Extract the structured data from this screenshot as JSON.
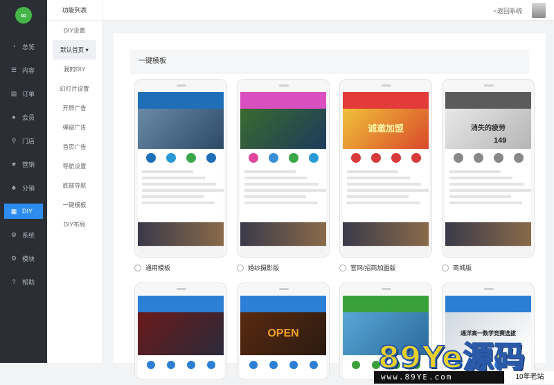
{
  "rail": {
    "items": [
      {
        "label": "总览",
        "icon": "pie-icon"
      },
      {
        "label": "内容",
        "icon": "list-icon"
      },
      {
        "label": "订单",
        "icon": "doc-icon"
      },
      {
        "label": "会员",
        "icon": "user-icon"
      },
      {
        "label": "门店",
        "icon": "pin-icon"
      },
      {
        "label": "营销",
        "icon": "star-icon"
      },
      {
        "label": "分销",
        "icon": "group-icon"
      },
      {
        "label": "DIY",
        "icon": "layout-icon"
      },
      {
        "label": "系统",
        "icon": "gear-icon"
      },
      {
        "label": "模块",
        "icon": "gear-icon"
      },
      {
        "label": "帮助",
        "icon": "help-icon"
      }
    ],
    "active_color": "#2d8cf0"
  },
  "submenu": {
    "title": "功能列表",
    "items": [
      "DIY设置",
      "默认首页",
      "我的DIY",
      "幻灯片设置",
      "开屏广告",
      "弹窗广告",
      "首页广告",
      "导航设置",
      "底部导航",
      "一键模板",
      "DIY布局"
    ],
    "dropdown_icon": "caret-down-icon"
  },
  "header": {
    "back_label": "<返回系统"
  },
  "panel": {
    "title": "一键模板"
  },
  "templates": [
    {
      "label": "通用模板",
      "theme": "#1e6fb8"
    },
    {
      "label": "婚纱摄影版",
      "theme": "#d94fc0"
    },
    {
      "label": "官网/招商加盟版",
      "theme": "#e33a3a"
    },
    {
      "label": "商城版",
      "theme": "#5b5b5b"
    },
    {
      "label": "",
      "theme": "#2d7fd6"
    },
    {
      "label": "",
      "theme": "#2d7fd6"
    },
    {
      "label": "",
      "theme": "#3aa13a"
    },
    {
      "label": "",
      "theme": "#2d7fd6"
    }
  ],
  "screen_text": {
    "franchise_banner": "诚邀加盟",
    "mall_banner": "消失的疲劳",
    "price": "149",
    "education_banner": "通洋高一数学竞赛选拔",
    "open_banner": "OPEN"
  },
  "watermark": {
    "brand": "89Ye源码",
    "url": "www.89YE.com",
    "tag": "10年老站"
  }
}
